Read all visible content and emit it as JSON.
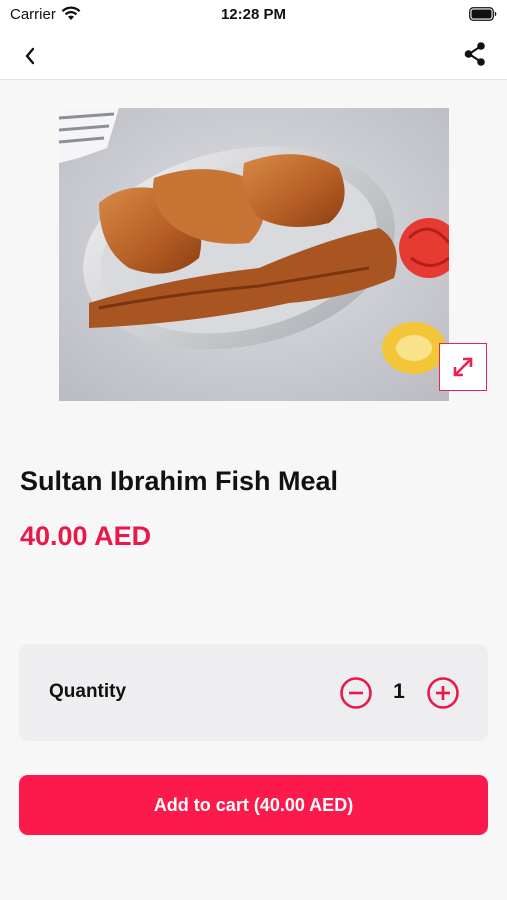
{
  "status_bar": {
    "carrier": "Carrier",
    "time": "12:28 PM",
    "icons": [
      "wifi-icon",
      "battery-icon"
    ]
  },
  "nav_bar": {
    "icons": [
      "back-chevron-icon",
      "share-icon"
    ]
  },
  "product": {
    "image_description_icon": "food-photo",
    "title": "Sultan Ibrahim Fish Meal",
    "price": "40.00 AED"
  },
  "quantity": {
    "label": "Quantity",
    "value": "1",
    "icons": [
      "minus-circle-icon",
      "plus-circle-icon"
    ]
  },
  "cart": {
    "button_label": "Add to cart (40.00 AED)"
  },
  "colors": {
    "accent": "#e8194a",
    "button": "#fb1a4b",
    "panel": "#eeeef1",
    "background": "#f7f7f8"
  }
}
